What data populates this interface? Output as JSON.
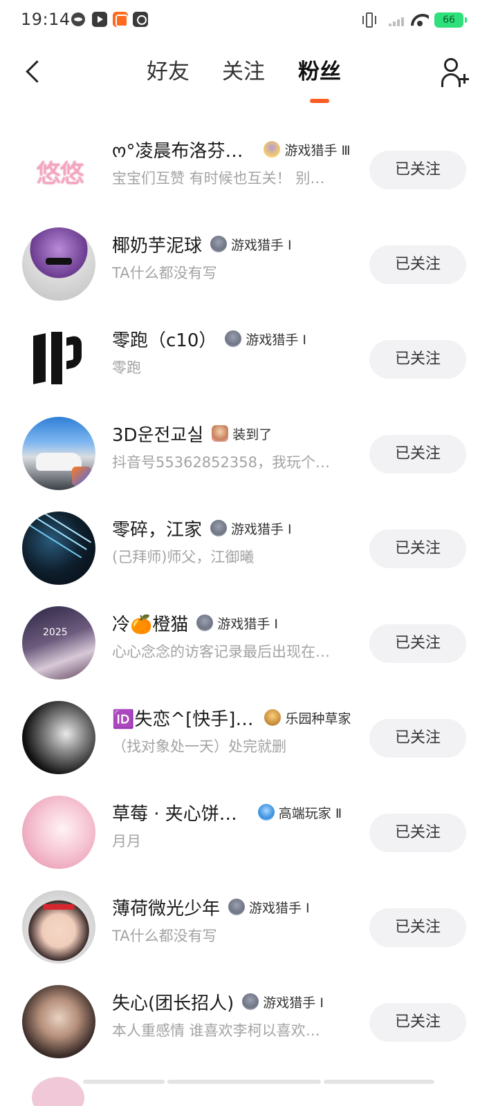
{
  "status_bar": {
    "time": "19:14",
    "battery": "66",
    "icons": [
      "loop-app-icon",
      "play-app-icon",
      "orange-app-icon",
      "music-app-icon",
      "vibrate-icon",
      "signal-icon",
      "wifi-icon",
      "battery-icon"
    ]
  },
  "header": {
    "tabs": [
      {
        "label": "好友"
      },
      {
        "label": "关注"
      },
      {
        "label": "粉丝"
      }
    ],
    "active_tab": "粉丝",
    "accent_color": "#ff5a1f"
  },
  "fans": [
    {
      "name": "ო°凌晨布洛芬…",
      "badge": "游戏猎手 Ⅲ",
      "badge_icon": "hunter-gold-badge-icon",
      "bio": "宝宝们互赞 有时候也互关！ 别…",
      "button": "已关注",
      "avatar_text": "悠悠"
    },
    {
      "name": "椰奶芋泥球",
      "badge": "游戏猎手 Ⅰ",
      "badge_icon": "hunter-badge-icon",
      "bio": "TA什么都没有写",
      "button": "已关注"
    },
    {
      "name": "零跑（c10）",
      "badge": "游戏猎手 Ⅰ",
      "badge_icon": "hunter-badge-icon",
      "bio": "零跑",
      "button": "已关注"
    },
    {
      "name": "3D운전교실",
      "badge": "装到了",
      "badge_icon": "checkin-badge-icon",
      "bio": "抖音号55362852358，我玩个…",
      "button": "已关注"
    },
    {
      "name": "零碎，江家",
      "badge": "游戏猎手 Ⅰ",
      "badge_icon": "hunter-badge-icon",
      "bio": "(己拜师)师父，江御曦",
      "button": "已关注"
    },
    {
      "name": "冷🍊橙猫",
      "badge": "游戏猎手 Ⅰ",
      "badge_icon": "hunter-badge-icon",
      "bio": "心心念念的访客记录最后出现在…",
      "button": "已关注"
    },
    {
      "name": "🆔失恋^[快手]…",
      "badge": "乐园种草家",
      "badge_icon": "garden-badge-icon",
      "bio": "（找对象处一天）处完就删",
      "button": "已关注"
    },
    {
      "name": "草莓 · 夹心饼…",
      "badge": "高端玩家 Ⅱ",
      "badge_icon": "pro-badge-icon",
      "bio": "月月",
      "button": "已关注"
    },
    {
      "name": "薄荷微光少年",
      "badge": "游戏猎手 Ⅰ",
      "badge_icon": "hunter-badge-icon",
      "bio": "TA什么都没有写",
      "button": "已关注"
    },
    {
      "name": "失心(团长招人)",
      "badge": "游戏猎手 Ⅰ",
      "badge_icon": "hunter-badge-icon",
      "bio": "本人重感情 谁喜欢李柯以喜欢…",
      "button": "已关注"
    }
  ]
}
